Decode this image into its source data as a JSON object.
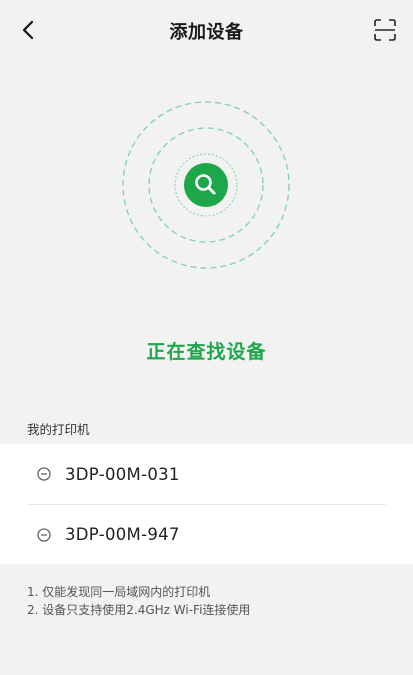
{
  "header": {
    "title": "添加设备"
  },
  "search": {
    "status": "正在查找设备"
  },
  "printers": {
    "section_title": "我的打印机",
    "items": [
      {
        "name": "3DP-00M-031"
      },
      {
        "name": "3DP-00M-947"
      }
    ]
  },
  "notes": {
    "line1": "1. 仅能发现同一局域网内的打印机",
    "line2": "2. 设备只支持使用2.4GHz Wi-Fi连接使用"
  },
  "icons": {
    "back": "chevron-left-icon",
    "scan": "scan-frame-icon",
    "search": "magnifier-icon",
    "remove": "minus-circle-icon"
  },
  "colors": {
    "accent": "#1ea64a",
    "radar_ring": "#7fd3a0",
    "background": "#f2f2f2"
  }
}
